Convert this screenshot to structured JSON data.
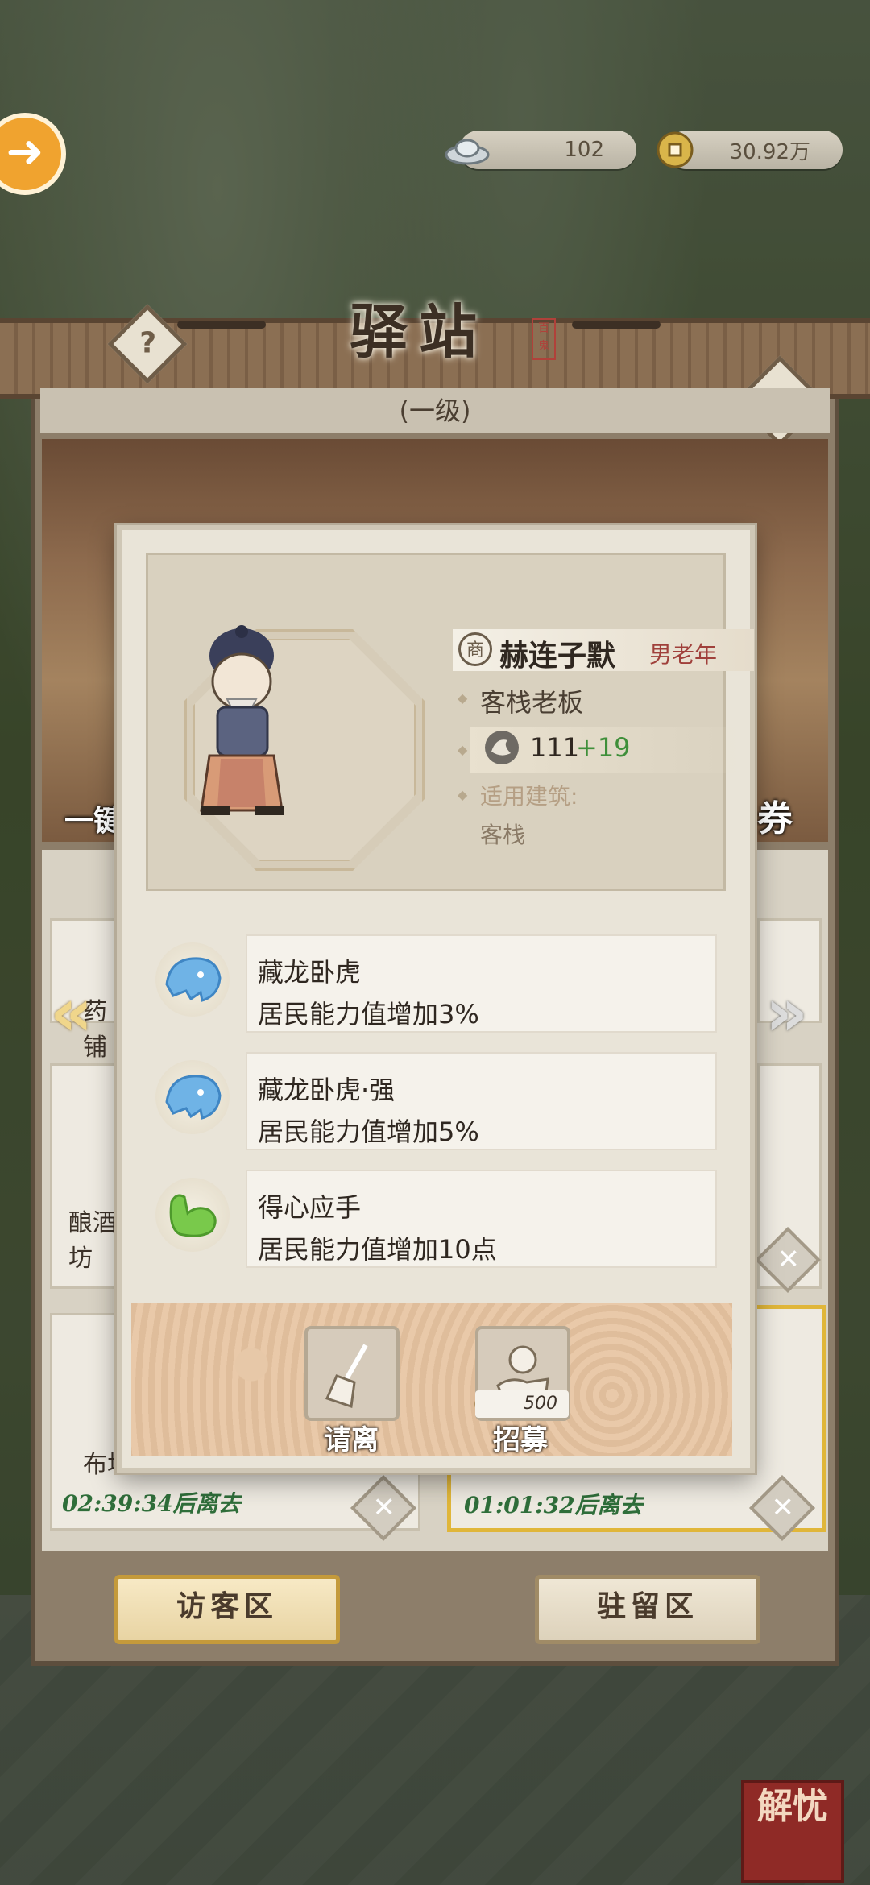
{
  "currency": {
    "silver": "102",
    "coins": "30.92万"
  },
  "station": {
    "title": "驿站",
    "seal": "百鬼",
    "level": "(一级)",
    "help_label": "?",
    "onekey_label": "一键",
    "voucher_label": "券"
  },
  "list": {
    "cards": [
      {
        "label": "药铺"
      },
      {
        "label": "酿酒坊"
      },
      {
        "label": "布坊",
        "timer": "02:39:34后离去"
      },
      {
        "label": "",
        "timer": "01:01:32后离去"
      }
    ]
  },
  "tabs": {
    "visitor": "访客区",
    "resident": "驻留区"
  },
  "bottom_seal": "解忧",
  "modal": {
    "name": "赫连子默",
    "name_badge": "商",
    "tags": "男老年",
    "occupation": "客栈老板",
    "power_base": "111",
    "power_bonus": "+19",
    "building_label": "适用建筑:",
    "building_value": "客栈",
    "skills": [
      {
        "name": "藏龙卧虎",
        "desc": "居民能力值增加3%",
        "icon": "tiger-icon"
      },
      {
        "name": "藏龙卧虎·强",
        "desc": "居民能力值增加5%",
        "icon": "tiger-icon"
      },
      {
        "name": "得心应手",
        "desc": "居民能力值增加10点",
        "icon": "arm-icon"
      }
    ],
    "actions": {
      "dismiss": "请离",
      "recruit": "招募",
      "recruit_cost": "500"
    }
  },
  "colors": {
    "accent_green": "#3f8f3a",
    "timer_green": "#2f6e3a",
    "tiger_blue": "#6fb3e6",
    "arm_green": "#79c94b"
  }
}
